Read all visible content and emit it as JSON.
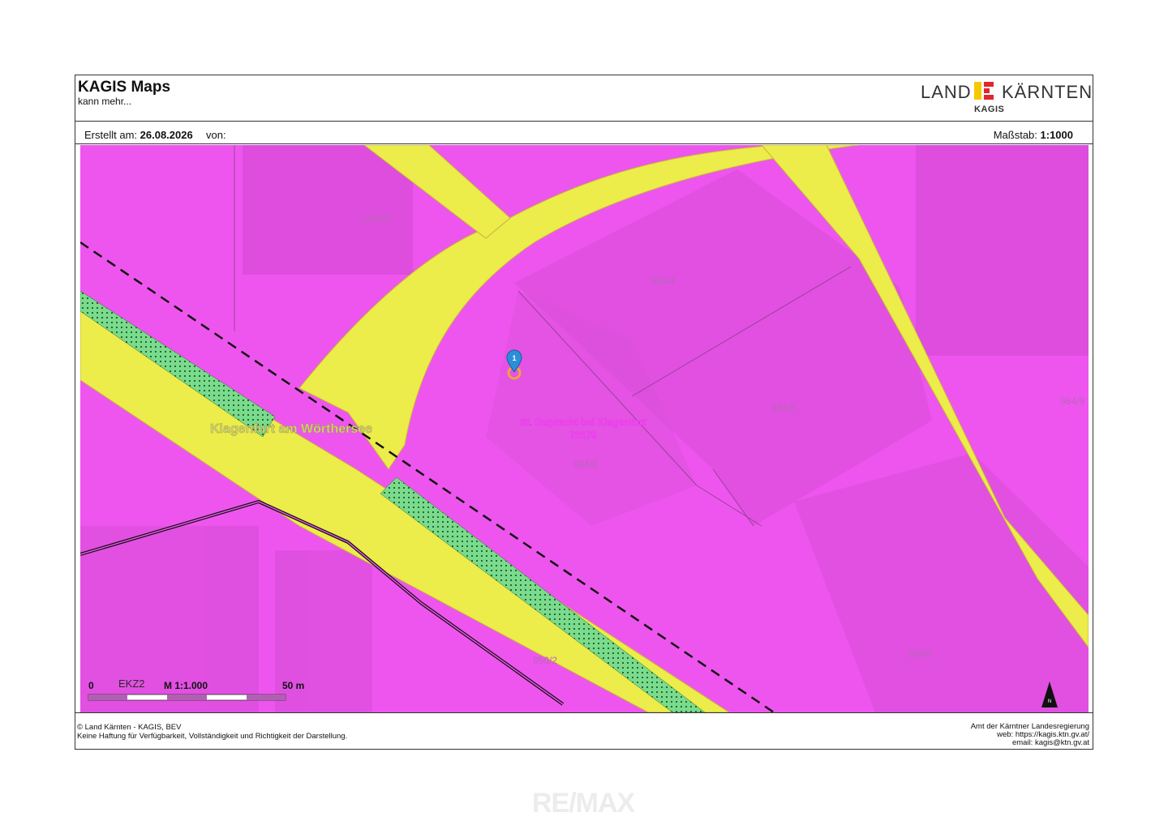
{
  "header": {
    "title": "KAGIS Maps",
    "subtitle": "kann mehr...",
    "logo_land": "LAND",
    "logo_kaernten": "KÄRNTEN",
    "logo_kagis": "KAGIS"
  },
  "infobar": {
    "created_label": "Erstellt am:",
    "created_date": "26.08.2026",
    "from_label": "von:",
    "scale_label": "Maßstab:",
    "scale_value": "1:1000"
  },
  "map": {
    "parcels": [
      "1029/2",
      "984/4",
      "984/5",
      "984/9",
      "984/6",
      "984/8",
      "950/2"
    ],
    "municipality_label": "Klagenfurt am Wörthersee",
    "cadastral_name": "St. Ruprecht bei Klagenfurt",
    "cadastral_number": "72175",
    "marker_number": "1",
    "scalebar": {
      "start": "0",
      "zone": "EKZ2",
      "scale_text": "M 1:1.000",
      "end": "50 m"
    },
    "north_label": "N",
    "colors": {
      "business_zone": "#ee55ee",
      "traffic_area": "#ecec4a",
      "green_strip": "#78dc8c",
      "marker": "#2a8fd8"
    }
  },
  "footer": {
    "copyright": "© Land Kärnten - KAGIS, BEV",
    "disclaimer": "Keine Haftung für Verfügbarkeit, Vollständigkeit und Richtigkeit der Darstellung.",
    "office": "Amt der Kärntner Landesregierung",
    "web": "web: https://kagis.ktn.gv.at/",
    "email": "email: kagis@ktn.gv.at"
  },
  "watermark": "RE/MAX"
}
